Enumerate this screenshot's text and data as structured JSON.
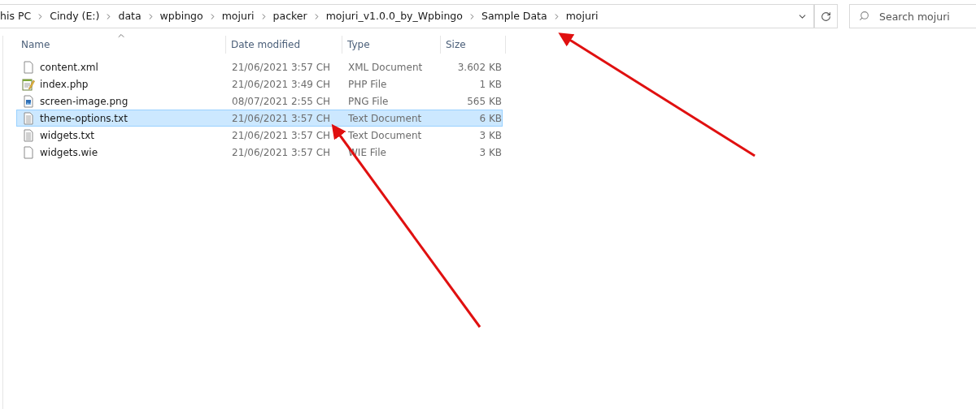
{
  "address_bar": {
    "path": [
      "his PC",
      "Cindy (E:)",
      "data",
      "wpbingo",
      "mojuri",
      "packer",
      "mojuri_v1.0.0_by_Wpbingo",
      "Sample Data",
      "mojuri"
    ]
  },
  "search": {
    "placeholder": "Search mojuri"
  },
  "columns": [
    {
      "label": "Name",
      "sorted": true
    },
    {
      "label": "Date modified",
      "sorted": false
    },
    {
      "label": "Type",
      "sorted": false
    },
    {
      "label": "Size",
      "sorted": false
    }
  ],
  "files": [
    {
      "name": "content.xml",
      "date": "21/06/2021 3:57 CH",
      "type": "XML Document",
      "size": "3.602 KB",
      "kind": "blank",
      "selected": false
    },
    {
      "name": "index.php",
      "date": "21/06/2021 3:49 CH",
      "type": "PHP File",
      "size": "1 KB",
      "kind": "script",
      "selected": false
    },
    {
      "name": "screen-image.png",
      "date": "08/07/2021 2:55 CH",
      "type": "PNG File",
      "size": "565 KB",
      "kind": "image",
      "selected": false
    },
    {
      "name": "theme-options.txt",
      "date": "21/06/2021 3:57 CH",
      "type": "Text Document",
      "size": "6 KB",
      "kind": "text",
      "selected": true
    },
    {
      "name": "widgets.txt",
      "date": "21/06/2021 3:57 CH",
      "type": "Text Document",
      "size": "3 KB",
      "kind": "text",
      "selected": false
    },
    {
      "name": "widgets.wie",
      "date": "21/06/2021 3:57 CH",
      "type": "WIE File",
      "size": "3 KB",
      "kind": "blank",
      "selected": false
    }
  ]
}
